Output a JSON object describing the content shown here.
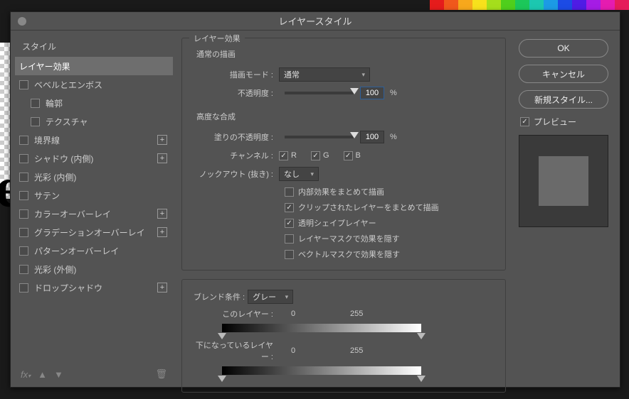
{
  "dialog": {
    "title": "レイヤースタイル"
  },
  "leftPanel": {
    "header": "スタイル",
    "items": [
      {
        "label": "レイヤー効果",
        "checkbox": false,
        "selected": true,
        "plus": false,
        "indent": false
      },
      {
        "label": "ベベルとエンボス",
        "checkbox": true,
        "selected": false,
        "plus": false,
        "indent": false
      },
      {
        "label": "輪郭",
        "checkbox": true,
        "selected": false,
        "plus": false,
        "indent": true
      },
      {
        "label": "テクスチャ",
        "checkbox": true,
        "selected": false,
        "plus": false,
        "indent": true
      },
      {
        "label": "境界線",
        "checkbox": true,
        "selected": false,
        "plus": true,
        "indent": false
      },
      {
        "label": "シャドウ (内側)",
        "checkbox": true,
        "selected": false,
        "plus": true,
        "indent": false
      },
      {
        "label": "光彩 (内側)",
        "checkbox": true,
        "selected": false,
        "plus": false,
        "indent": false
      },
      {
        "label": "サテン",
        "checkbox": true,
        "selected": false,
        "plus": false,
        "indent": false
      },
      {
        "label": "カラーオーバーレイ",
        "checkbox": true,
        "selected": false,
        "plus": true,
        "indent": false
      },
      {
        "label": "グラデーションオーバーレイ",
        "checkbox": true,
        "selected": false,
        "plus": true,
        "indent": false
      },
      {
        "label": "パターンオーバーレイ",
        "checkbox": true,
        "selected": false,
        "plus": false,
        "indent": false
      },
      {
        "label": "光彩 (外側)",
        "checkbox": true,
        "selected": false,
        "plus": false,
        "indent": false
      },
      {
        "label": "ドロップシャドウ",
        "checkbox": true,
        "selected": false,
        "plus": true,
        "indent": false
      }
    ]
  },
  "mid": {
    "sectionTitle": "レイヤー効果",
    "normalDraw": "通常の描画",
    "blendModeLabel": "描画モード :",
    "blendModeValue": "通常",
    "opacityLabel": "不透明度 :",
    "opacityValue": "100",
    "unitPct": "%",
    "advTitle": "高度な合成",
    "fillOpacityLabel": "塗りの不透明度 :",
    "fillOpacityValue": "100",
    "channelLabel": "チャンネル :",
    "chR": "R",
    "chG": "G",
    "chB": "B",
    "knockoutLabel": "ノックアウト (抜き) :",
    "knockoutValue": "なし",
    "adv1": "内部効果をまとめて描画",
    "adv2": "クリップされたレイヤーをまとめて描画",
    "adv3": "透明シェイプレイヤー",
    "adv4": "レイヤーマスクで効果を隠す",
    "adv5": "ベクトルマスクで効果を隠す",
    "blendIfLabel": "ブレンド条件 :",
    "blendIfValue": "グレー",
    "thisLayerLabel": "このレイヤー :",
    "thisLow": "0",
    "thisHigh": "255",
    "underLayerLabel": "下になっているレイヤー :",
    "underLow": "0",
    "underHigh": "255"
  },
  "right": {
    "ok": "OK",
    "cancel": "キャンセル",
    "newStyle": "新規スタイル...",
    "preview": "プレビュー"
  },
  "swatchColors": [
    "#e51c1c",
    "#f0581c",
    "#f7a81c",
    "#f7e11c",
    "#a5de1c",
    "#4fcf1c",
    "#1cc75a",
    "#1cc7b0",
    "#1c9be5",
    "#1c4be5",
    "#4f1ce5",
    "#a51ce5",
    "#e51cb0",
    "#e51c5a"
  ]
}
